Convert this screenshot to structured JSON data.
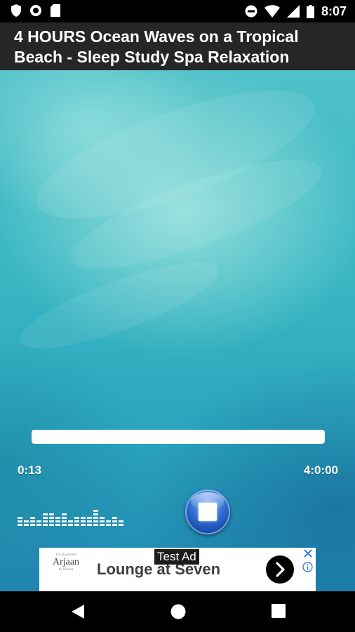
{
  "status_bar": {
    "time": "8:07",
    "left_icons": [
      "shield-icon",
      "circle-dot-icon",
      "sd-card-icon"
    ],
    "right_icons": [
      "do-not-disturb-icon",
      "wifi-icon",
      "signal-icon",
      "battery-icon"
    ]
  },
  "title_bar": {
    "title": "4 HOURS Ocean Waves on a Tropical Beach - Sleep Study Spa Relaxation"
  },
  "player": {
    "elapsed": "0:13",
    "total": "4:0:00",
    "progress_fraction": 0.999,
    "equalizer_levels": [
      3,
      2,
      3,
      2,
      4,
      4,
      3,
      4,
      2,
      3,
      3,
      3,
      5,
      3,
      2,
      3,
      2
    ],
    "stop_button": "stop"
  },
  "ad": {
    "label": "Test Ad",
    "logo_top": "The Boulevard",
    "logo_main": "Arjaan",
    "logo_sub": "by Rotana",
    "headline": "Lounge at Seven",
    "cta_icon": "chevron-right-icon"
  },
  "nav_bar": {
    "buttons": [
      "back-icon",
      "home-icon",
      "recents-icon"
    ]
  },
  "colors": {
    "title_bar_bg": "#262626",
    "background_teal": "#38b6c2",
    "stop_button_blue": "#2f6fd2"
  }
}
